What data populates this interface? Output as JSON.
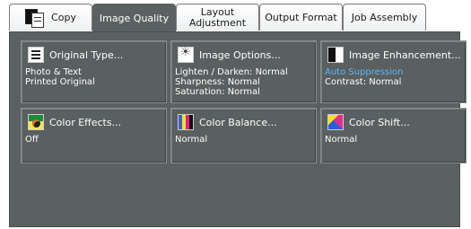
{
  "tabs": [
    {
      "label": "Copy"
    },
    {
      "label": "Image Quality"
    },
    {
      "label_line1": "Layout",
      "label_line2": "Adjustment"
    },
    {
      "label": "Output Format"
    },
    {
      "label": "Job Assembly"
    }
  ],
  "buttons": {
    "original_type": {
      "title": "Original Type...",
      "values": [
        "Photo & Text",
        "Printed Original"
      ],
      "icon": "document-icon"
    },
    "image_options": {
      "title": "Image Options...",
      "values": [
        "Lighten / Darken: Normal",
        "Sharpness: Normal",
        "Saturation: Normal"
      ],
      "icon": "brightness-icon"
    },
    "image_enhancement": {
      "title": "Image Enhancement...",
      "values": [
        "Auto Suppression",
        "Contrast: Normal"
      ],
      "icon": "contrast-icon"
    },
    "color_effects": {
      "title": "Color Effects...",
      "values": [
        "Off"
      ],
      "icon": "color-effects-icon"
    },
    "color_balance": {
      "title": "Color Balance...",
      "values": [
        "Normal"
      ],
      "icon": "color-balance-icon"
    },
    "color_shift": {
      "title": "Color Shift...",
      "values": [
        "Normal"
      ],
      "icon": "color-shift-icon"
    }
  },
  "colors": {
    "panel_bg": "#5b6060",
    "highlight_text": "#59b8ff",
    "balance_bars": [
      "#3b5fe0",
      "#f0e22a",
      "#d4287e",
      "#111111"
    ]
  }
}
